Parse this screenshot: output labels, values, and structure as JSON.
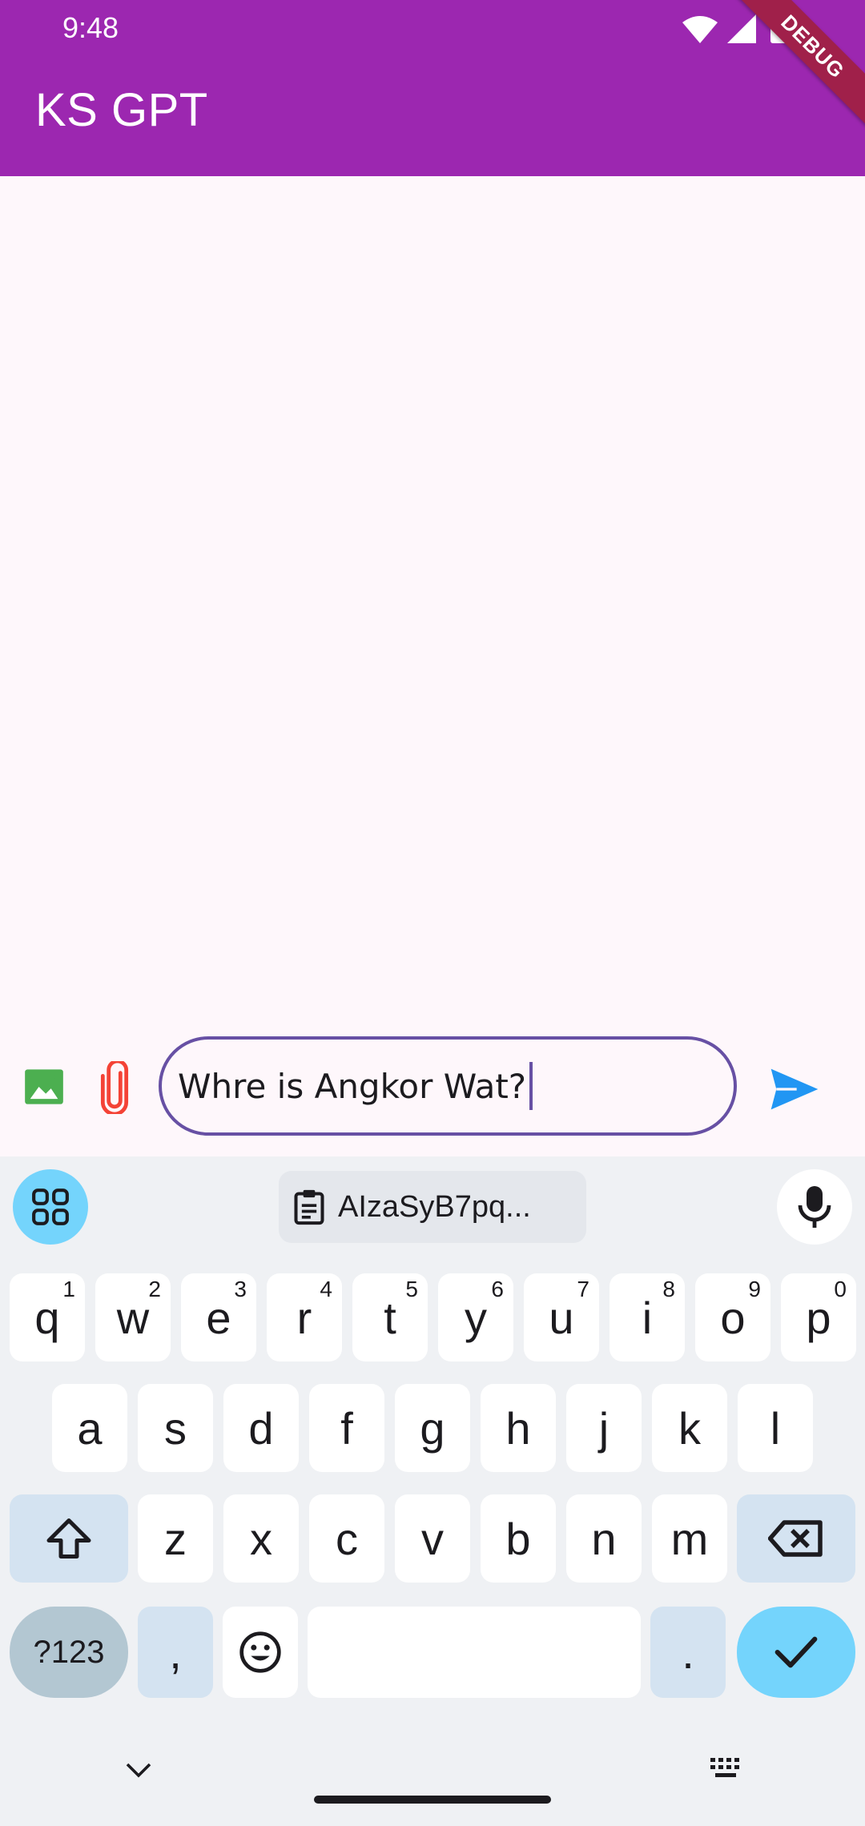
{
  "status_bar": {
    "time": "9:48"
  },
  "app_bar": {
    "title": "KS GPT",
    "debug_label": "DEBUG"
  },
  "composer": {
    "input_value": "Whre is Angkor Wat?"
  },
  "keyboard": {
    "clipboard_chip": "AIzaSyB7pq...",
    "row1": [
      {
        "label": "q",
        "hint": "1"
      },
      {
        "label": "w",
        "hint": "2"
      },
      {
        "label": "e",
        "hint": "3"
      },
      {
        "label": "r",
        "hint": "4"
      },
      {
        "label": "t",
        "hint": "5"
      },
      {
        "label": "y",
        "hint": "6"
      },
      {
        "label": "u",
        "hint": "7"
      },
      {
        "label": "i",
        "hint": "8"
      },
      {
        "label": "o",
        "hint": "9"
      },
      {
        "label": "p",
        "hint": "0"
      }
    ],
    "row2": [
      "a",
      "s",
      "d",
      "f",
      "g",
      "h",
      "j",
      "k",
      "l"
    ],
    "row3": [
      "z",
      "x",
      "c",
      "v",
      "b",
      "n",
      "m"
    ],
    "row4": {
      "symbols": "?123",
      "comma": ",",
      "period": "."
    }
  },
  "colors": {
    "app_bar": "#9c27b0",
    "accent": "#6750a4",
    "send": "#2196f3",
    "image_icon": "#4caf50",
    "attach_icon": "#f44336",
    "keyboard_accent": "#74d4fc"
  }
}
